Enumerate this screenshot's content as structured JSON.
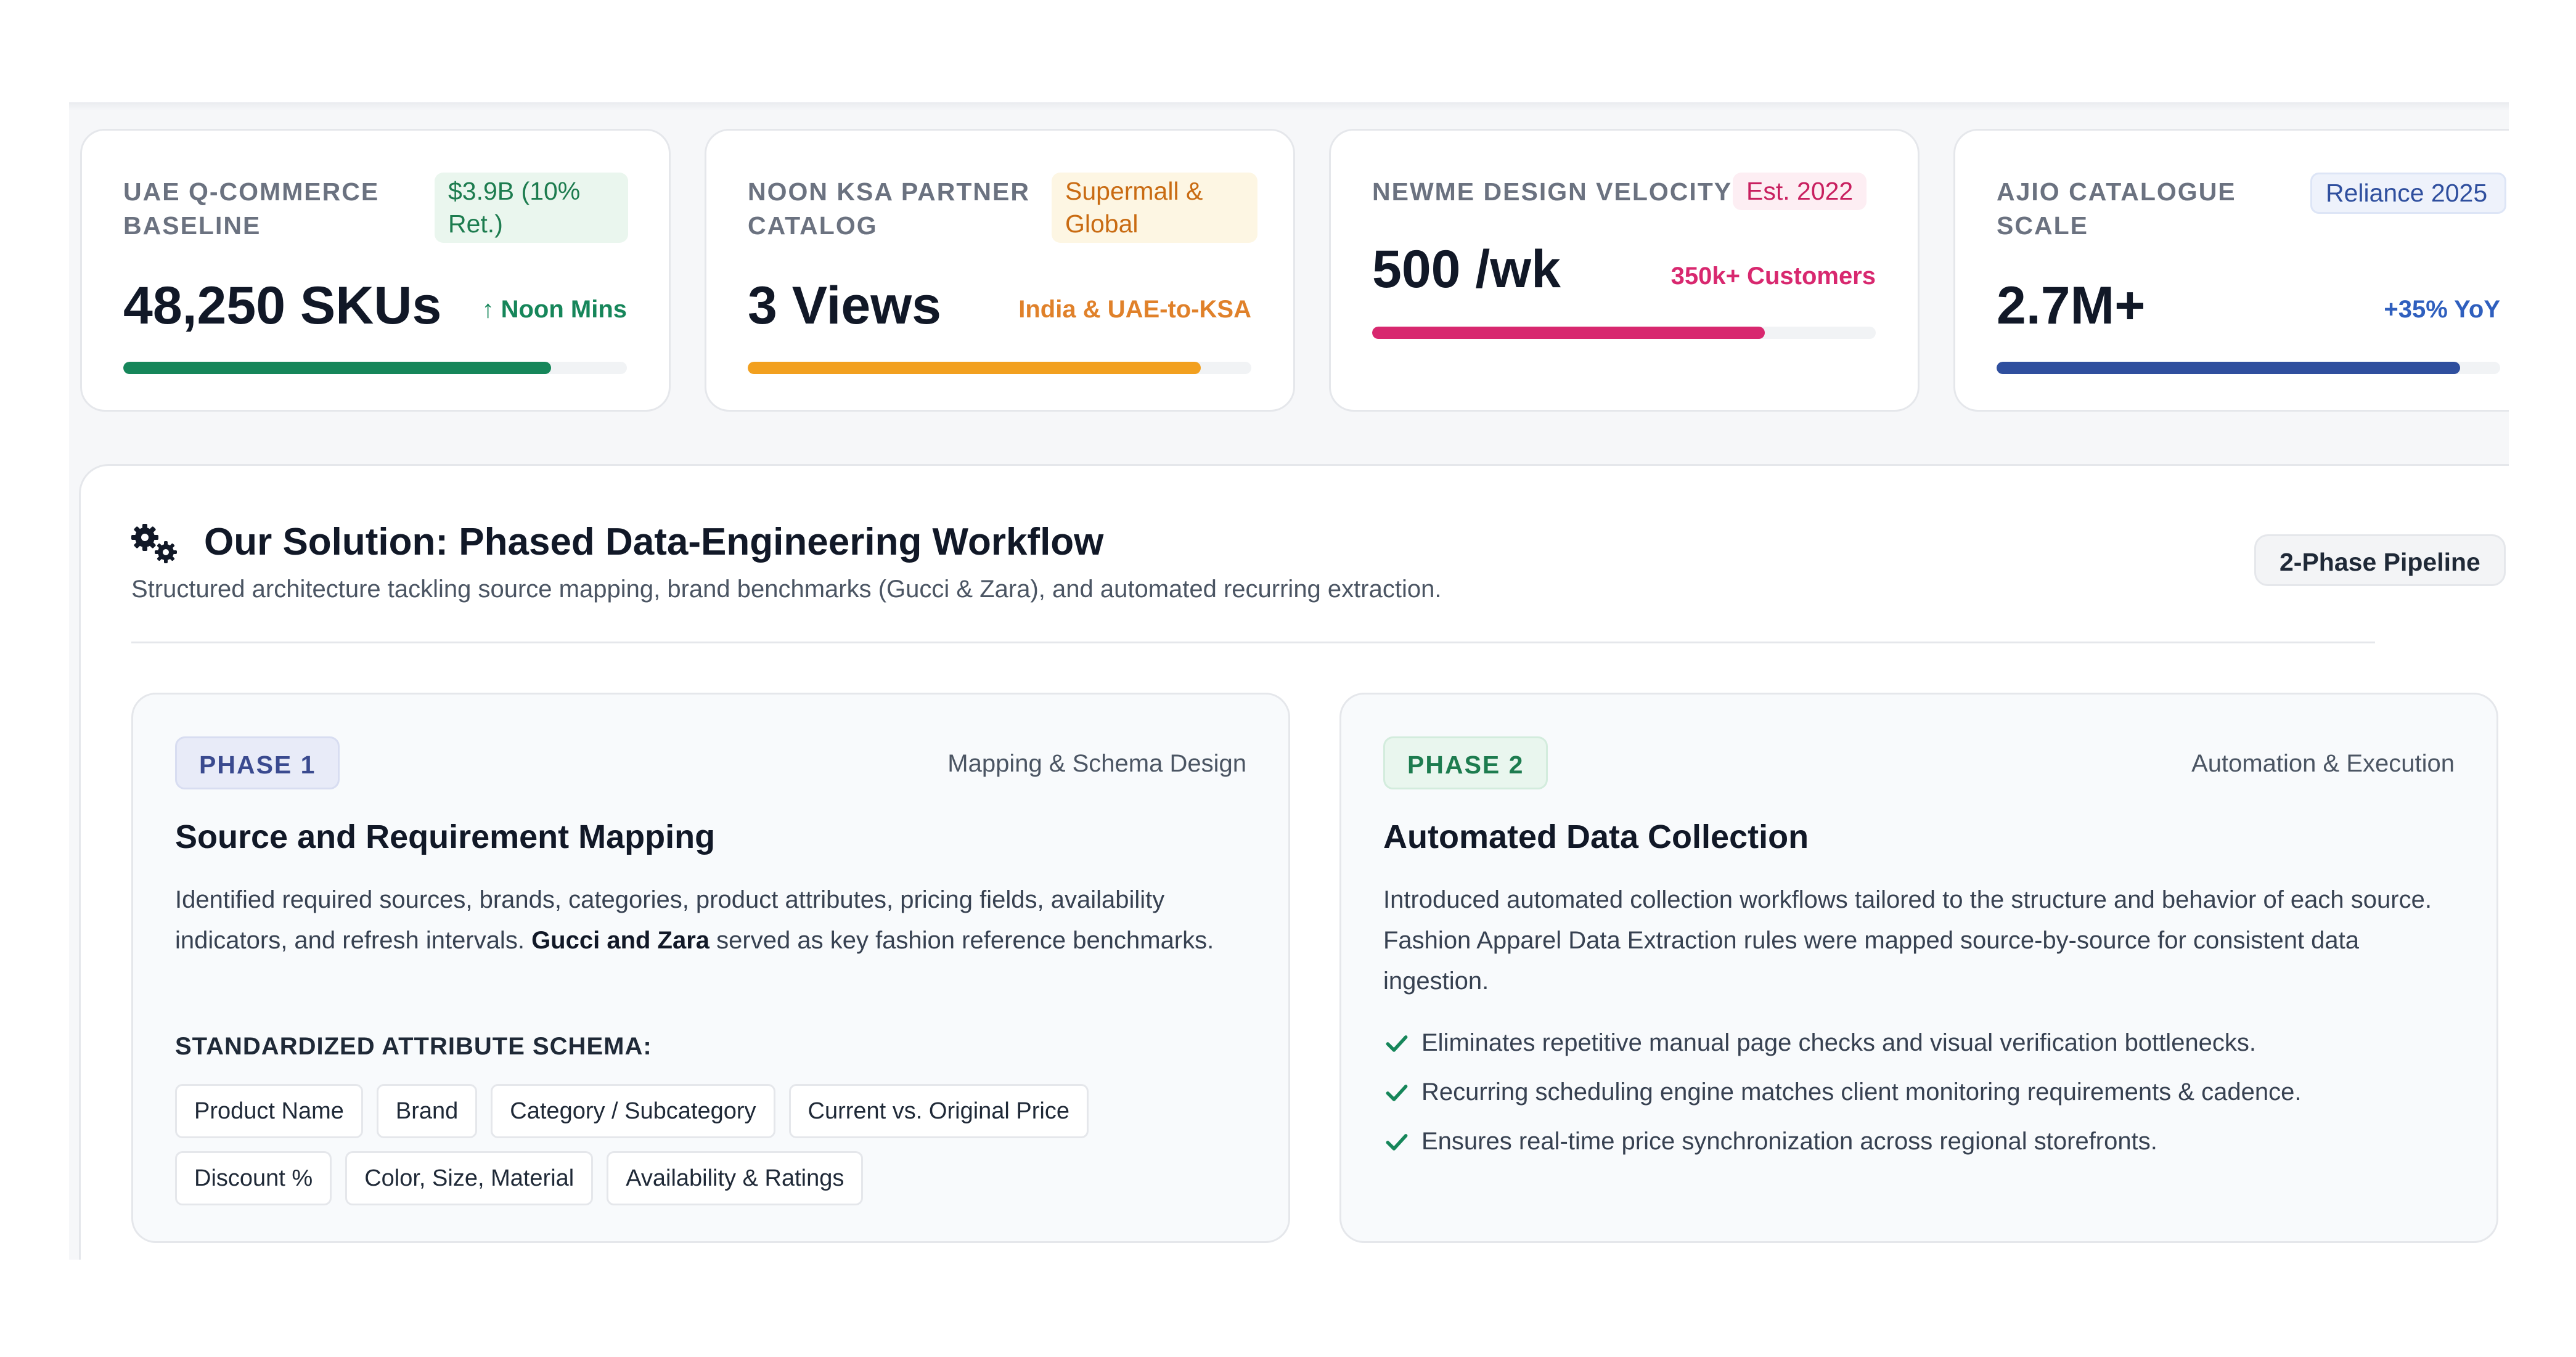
{
  "colors": {
    "green": "#16865a",
    "amber": "#f2a01f",
    "pink": "#d8286f",
    "blue": "#2f4f9e"
  },
  "metrics": [
    {
      "label": "UAE Q-COMMERCE BASELINE",
      "badge": "$3.9B (10% Ret.)",
      "value": "48,250 SKUs",
      "sub": "Noon Mins",
      "progress": 0.85
    },
    {
      "label": "NOON KSA PARTNER CATALOG",
      "badge": "Supermall & Global",
      "value": "3 Views",
      "sub": "India & UAE-to-KSA",
      "progress": 0.9
    },
    {
      "label": "NEWME DESIGN VELOCITY",
      "badge": "Est. 2022",
      "value": "500 /wk",
      "sub": "350k+ Customers",
      "progress": 0.78
    },
    {
      "label": "AJIO CATALOGUE SCALE",
      "badge": "Reliance 2025",
      "value": "2.7M+",
      "sub": "+35% YoY",
      "progress": 0.92
    }
  ],
  "solution": {
    "title": "Our Solution: Phased Data-Engineering Workflow",
    "subtitle": "Structured architecture tackling source mapping, brand benchmarks (Gucci & Zara), and automated recurring extraction.",
    "badge": "2-Phase Pipeline",
    "icon": "gears-icon",
    "phase1": {
      "tag": "PHASE 1",
      "caption": "Mapping & Schema Design",
      "title": "Source and Requirement Mapping",
      "desc_before": "Identified required sources, brands, categories, product attributes, pricing fields, availability indicators, and refresh intervals.",
      "desc_bold": "Gucci and Zara",
      "desc_after": "served as key fashion reference benchmarks.",
      "schema_label": "STANDARDIZED ATTRIBUTE SCHEMA:",
      "chips_row1": [
        "Product Name",
        "Brand",
        "Category / Subcategory",
        "Current vs. Original Price"
      ],
      "chips_row2": [
        "Discount %",
        "Color, Size, Material",
        "Availability & Ratings"
      ]
    },
    "phase2": {
      "tag": "PHASE 2",
      "caption": "Automation & Execution",
      "title": "Automated Data Collection",
      "desc": "Introduced automated collection workflows tailored to the structure and behavior of each source. Fashion Apparel Data Extraction rules were mapped source-by-source for consistent data ingestion.",
      "bullets": [
        "Eliminates repetitive manual page checks and visual verification bottlenecks.",
        "Recurring scheduling engine matches client monitoring requirements & cadence.",
        "Ensures real-time price synchronization across regional storefronts."
      ]
    }
  }
}
